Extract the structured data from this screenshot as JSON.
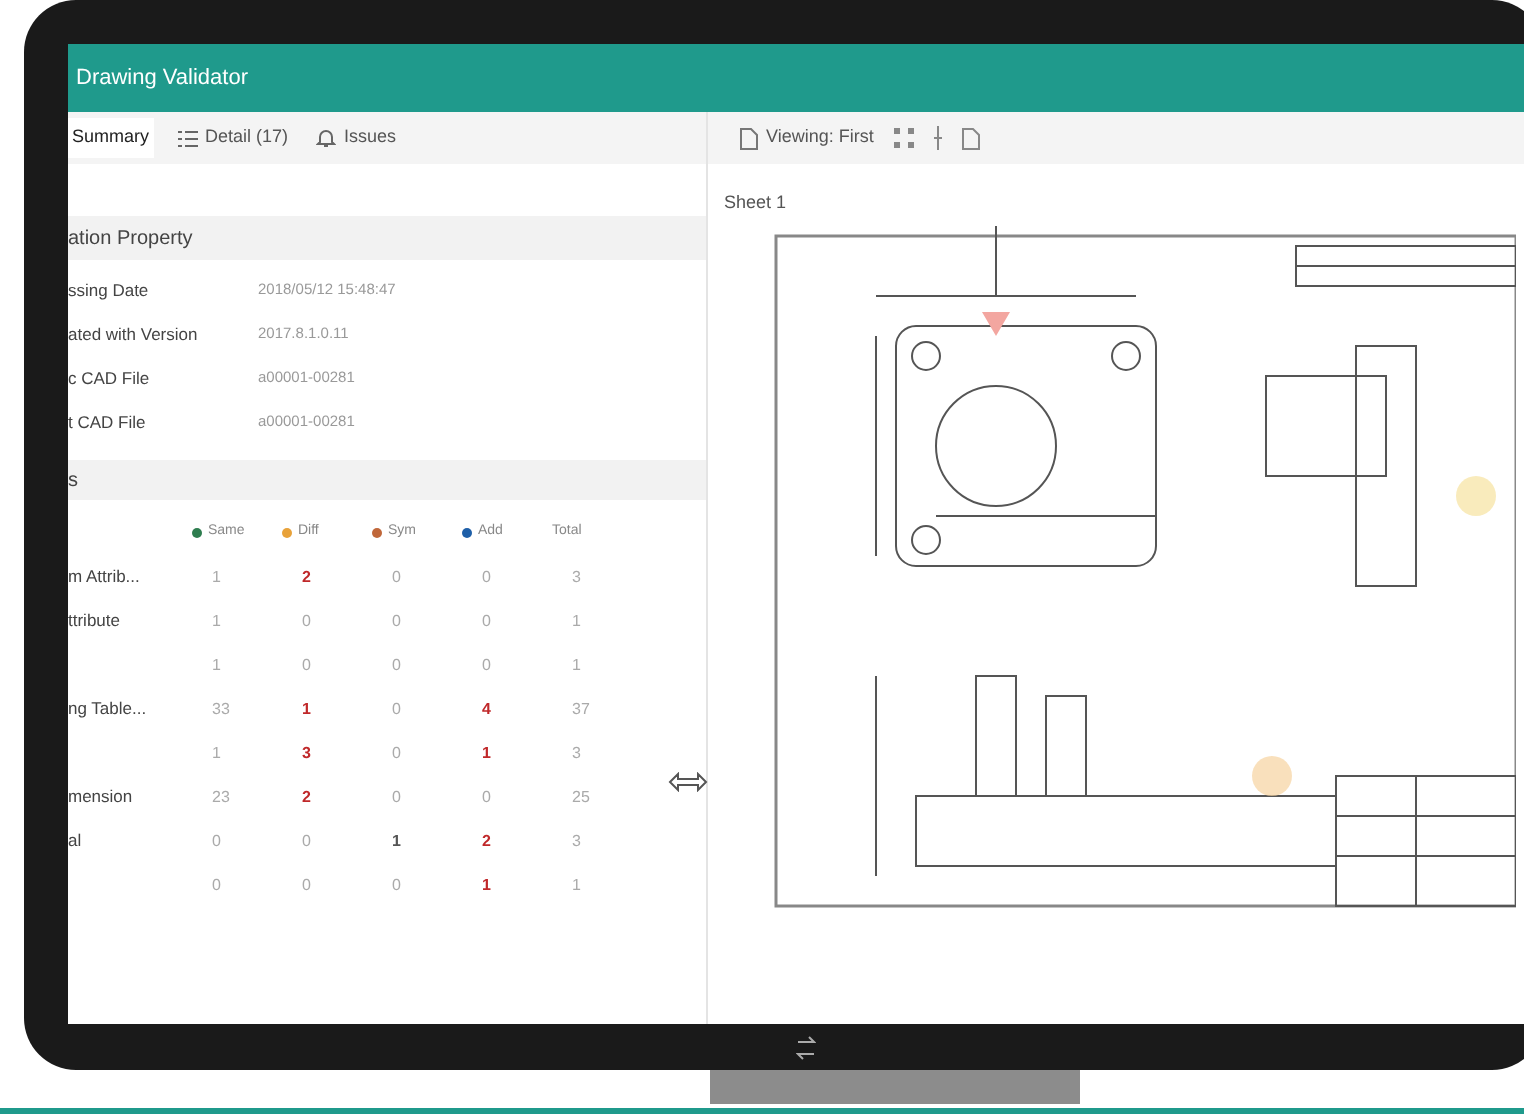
{
  "window": {
    "title": "Drawing Validator"
  },
  "tabs": [
    {
      "label": "Summary",
      "kind": "plain",
      "selected": true
    },
    {
      "label": "Detail (17)",
      "kind": "list",
      "selected": false
    },
    {
      "label": "Issues",
      "kind": "alert",
      "selected": false
    }
  ],
  "property_section": {
    "title": "ation Property",
    "rows": [
      {
        "label": "ssing Date",
        "value": "2018/05/12 15:48:47"
      },
      {
        "label": "ated with Version",
        "value": "2017.8.1.0.11"
      },
      {
        "label": "c CAD File",
        "value": "a00001-00281"
      },
      {
        "label": "t CAD File",
        "value": "a00001-00281"
      }
    ]
  },
  "summary_section": {
    "title": "s",
    "columns": [
      {
        "label": "Same",
        "color": "#2e7d4f"
      },
      {
        "label": "Diff",
        "color": "#e8a23a"
      },
      {
        "label": "Sym",
        "color": "#c0673a"
      },
      {
        "label": "Add",
        "color": "#1e5fa8"
      },
      {
        "label": "Total"
      }
    ],
    "rows": [
      {
        "label": "m Attrib...",
        "cells": [
          "1",
          "2",
          "0",
          "0",
          "3"
        ]
      },
      {
        "label": "ttribute",
        "cells": [
          "1",
          "0",
          "0",
          "0",
          "1"
        ]
      },
      {
        "cells": [
          "1",
          "0",
          "0",
          "0",
          "1"
        ]
      },
      {
        "label": "ng Table...",
        "cells": [
          "33",
          "1",
          "0",
          "4",
          "37"
        ]
      },
      {
        "cells": [
          "1",
          "3",
          "0",
          "1",
          "3"
        ]
      },
      {
        "label": "mension",
        "cells": [
          "23",
          "2",
          "0",
          "0",
          "25"
        ]
      },
      {
        "label": "al",
        "cells": [
          "0",
          "0",
          "1",
          "2",
          "3"
        ]
      },
      {
        "cells": [
          "0",
          "0",
          "0",
          "1",
          "1"
        ]
      }
    ]
  },
  "viewer": {
    "toolbar": {
      "label": "Viewing: First"
    },
    "sheet_label": "Sheet 1"
  }
}
